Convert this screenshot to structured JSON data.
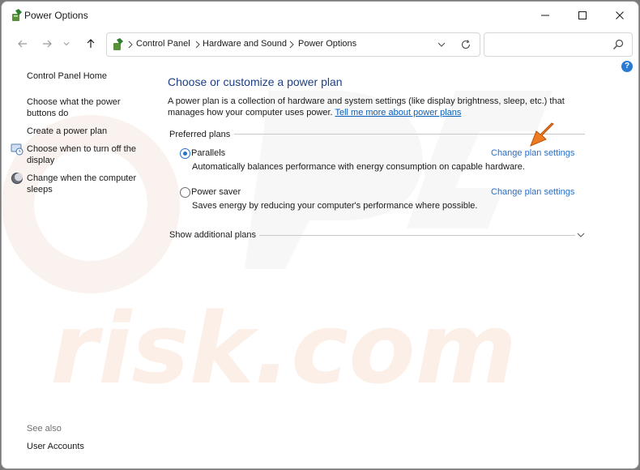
{
  "window": {
    "title": "Power Options"
  },
  "address_bar": {
    "breadcrumbs": [
      "Control Panel",
      "Hardware and Sound",
      "Power Options"
    ],
    "search_placeholder": ""
  },
  "sidebar": {
    "home": "Control Panel Home",
    "links": [
      {
        "label": "Choose what the power buttons do",
        "icon": ""
      },
      {
        "label": "Create a power plan",
        "icon": ""
      },
      {
        "label": "Choose when to turn off the display",
        "icon": "monitor-clock-icon"
      },
      {
        "label": "Change when the computer sleeps",
        "icon": "moon-sleep-icon"
      }
    ],
    "see_also": "See also",
    "user_accounts": "User Accounts"
  },
  "main": {
    "heading": "Choose or customize a power plan",
    "description": "A power plan is a collection of hardware and system settings (like display brightness, sleep, etc.) that manages how your computer uses power.",
    "learn_more": "Tell me more about power plans",
    "preferred_label": "Preferred plans",
    "plans": [
      {
        "name": "Parallels",
        "selected": true,
        "description": "Automatically balances performance with energy consumption on capable hardware.",
        "link": "Change plan settings"
      },
      {
        "name": "Power saver",
        "selected": false,
        "description": "Saves energy by reducing your computer's performance where possible.",
        "link": "Change plan settings"
      }
    ],
    "show_additional": "Show additional plans"
  },
  "colors": {
    "heading": "#1e3f84",
    "link": "#2a6fc9",
    "annotation_arrow": "#f07a1f"
  }
}
